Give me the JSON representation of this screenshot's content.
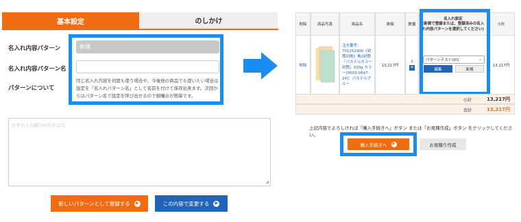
{
  "left": {
    "tab_basic": "基本設定",
    "tab_noshi": "のしかけ",
    "label_pattern": "名入れ内容パターン",
    "label_pattern_name": "名入れ内容パターン名",
    "label_about": "パターンについて",
    "pattern_value": "新規",
    "pattern_name_value": "",
    "about_text": "同じ名入れ内容を何度も使う場合や、今後他の商品でも使いたい場合は設定を「名入れパターン名」として名前を付けて保存出来ます。次回からはパターン名で設定を呼び出せるので御購示が簡単です。",
    "textarea_placeholder": "文字以入力欄100文字以内",
    "btn_register_new": "新しいパターンとして登録する",
    "btn_change": "この内容で変更する"
  },
  "right": {
    "headers": {
      "delete": "削除",
      "photo": "商品写真",
      "name": "商品名",
      "unit_price": "単価",
      "qty": "数量",
      "naire_title": "名入れ設定",
      "naire_sub": "(新規で登録または、登録済みの名入れ内容パターンを選択してください)",
      "subtotal": "小計"
    },
    "row": {
      "delete": "削除",
      "product_name": "注文番号：701252900《封筒印刷》角2封筒「パステルカラー封筒」100g カラー[0603-0647-24]：パステルブルー",
      "unit_price": "13,217円",
      "qty": "1",
      "select_value": "パターンテスト001",
      "btn_edit": "編集",
      "btn_new": "新規",
      "subtotal": "13,217円"
    },
    "summary": {
      "subtotal_label": "小計",
      "subtotal_value": "13,217円",
      "total_label": "合計",
      "total_value": "13,217円"
    },
    "notice": "上記内容でよろしければ「購入手続きへ」ボタン または「お見積作成」ボタン をクリックしてください。",
    "btn_checkout": "購入手続きへ",
    "btn_estimate": "お見積り作成"
  },
  "colors": {
    "accent_orange": "#ef6c13",
    "accent_blue": "#2264b8",
    "highlight": "#1a8ef0"
  }
}
